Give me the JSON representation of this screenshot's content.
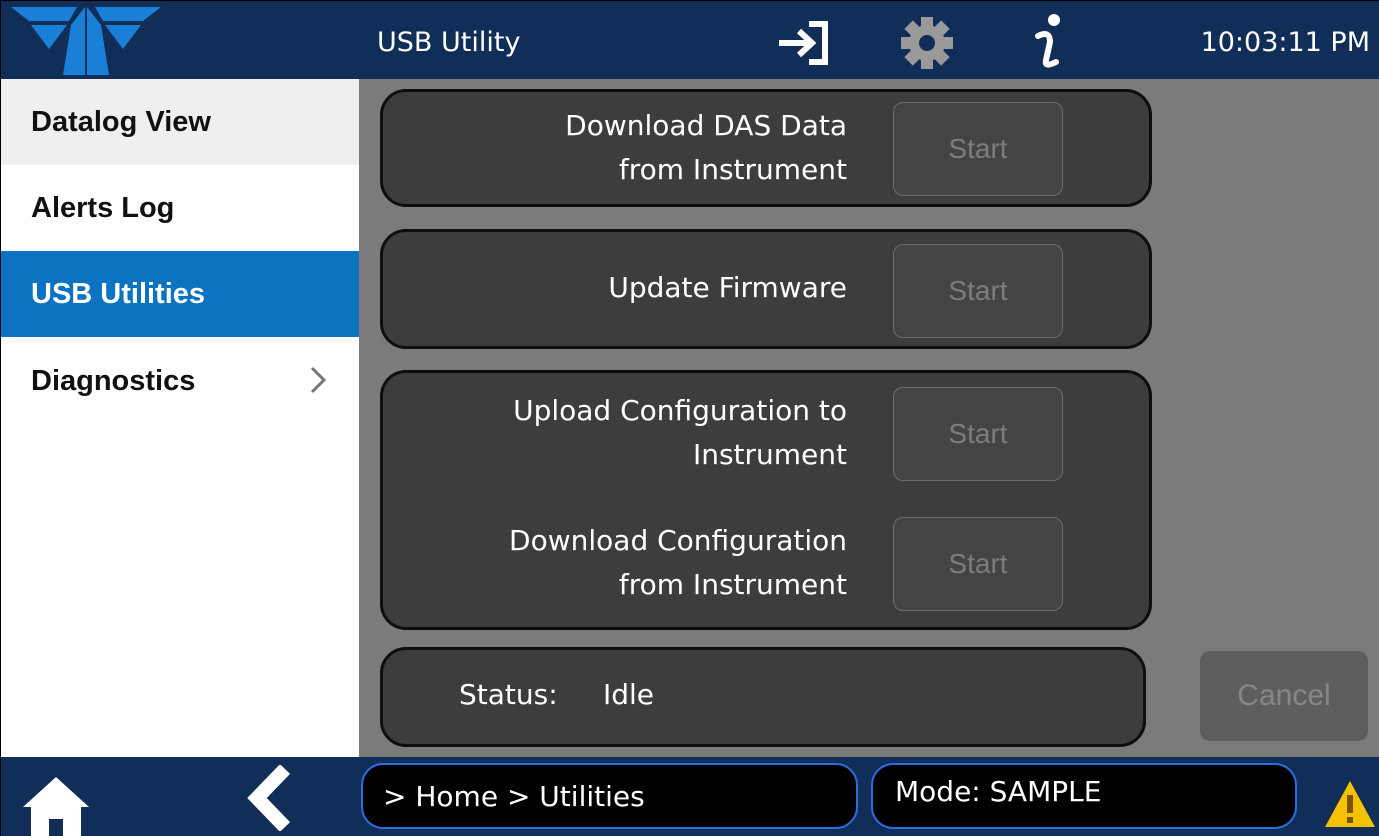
{
  "header": {
    "title": "USB Utility",
    "time": "10:03:11 PM",
    "icons": [
      "logo-icon",
      "login-icon",
      "gear-icon",
      "info-icon"
    ]
  },
  "sidebar": {
    "items": [
      {
        "label": "Datalog View",
        "state": "normal-gray"
      },
      {
        "label": "Alerts Log",
        "state": "normal"
      },
      {
        "label": "USB Utilities",
        "state": "active"
      },
      {
        "label": "Diagnostics",
        "state": "normal",
        "has_submenu": true
      }
    ]
  },
  "main": {
    "panels": [
      {
        "label_line1": "Download DAS Data",
        "label_line2": "from Instrument",
        "button": "Start"
      },
      {
        "label_line1": "Update Firmware",
        "button": "Start"
      },
      {
        "label_line1": "Upload Configuration to",
        "label_line2": "Instrument",
        "button": "Start"
      },
      {
        "label_line1": "Download Configuration",
        "label_line2": "from Instrument",
        "button": "Start"
      }
    ],
    "status_label": "Status:",
    "status_value": "Idle",
    "cancel_label": "Cancel"
  },
  "footer": {
    "breadcrumb": "> Home > Utilities",
    "mode": "Mode: SAMPLE"
  },
  "colors": {
    "header_bg": "#102e57",
    "active_blue": "#0b73c1",
    "content_bg": "#7b7b7b",
    "panel_bg": "#3d3d3d",
    "warning_yellow": "#f4c200"
  }
}
